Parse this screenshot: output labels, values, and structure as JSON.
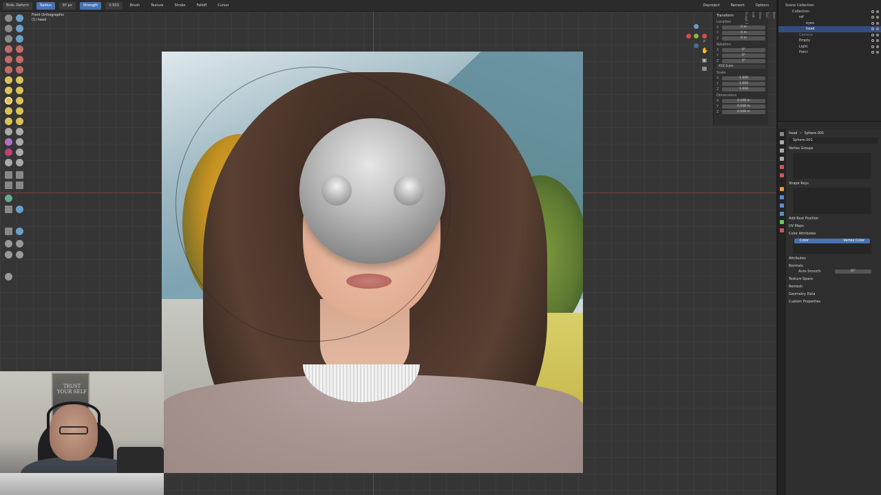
{
  "header": {
    "mode": "Blob",
    "brush_name": "Deform",
    "radius_label": "Radius",
    "radius_value": "97 px",
    "strength_label": "Strength",
    "strength_value": "0.503",
    "menus": [
      "Brush",
      "Texture",
      "Stroke",
      "Falloff",
      "Cursor"
    ]
  },
  "viewport": {
    "view_name": "Front Orthographic",
    "object_label": "(1) head"
  },
  "header_right": [
    "Deproject",
    "Remesh",
    "Options"
  ],
  "npanel": {
    "title": "Transform",
    "location_label": "Location",
    "location": [
      "0 m",
      "0 m",
      "0 m"
    ],
    "rotation_label": "Rotation",
    "rotation": [
      "0°",
      "0°",
      "0°"
    ],
    "rotation_mode": "XYZ Euler",
    "scale_label": "Scale",
    "scale": [
      "1.000",
      "1.000",
      "1.000"
    ],
    "dimensions_label": "Dimensions",
    "dimensions": [
      "0.108 m",
      "0.108 m",
      "0.108 m"
    ],
    "axes": [
      "X",
      "Y",
      "Z"
    ],
    "tabs": [
      "Item",
      "Tool",
      "View",
      "Edit",
      "Sculpt 2"
    ]
  },
  "outliner": {
    "rows": [
      {
        "label": "Scene Collection",
        "indent": 0,
        "selected": false
      },
      {
        "label": "Collection",
        "indent": 1,
        "selected": false
      },
      {
        "label": "ref",
        "indent": 2,
        "selected": false
      },
      {
        "label": "eyes",
        "indent": 3,
        "selected": false
      },
      {
        "label": "head",
        "indent": 3,
        "selected": true
      },
      {
        "label": "Camera",
        "indent": 2,
        "selected": false
      },
      {
        "label": "Empty",
        "indent": 2,
        "selected": false
      },
      {
        "label": "Light",
        "indent": 2,
        "selected": false
      },
      {
        "label": "Point",
        "indent": 2,
        "selected": false
      }
    ]
  },
  "properties": {
    "breadcrumb_object": "head",
    "breadcrumb_mesh": "Sphere.001",
    "mesh_name": "Sphere.001",
    "vertex_groups": "Vertex Groups",
    "shape_keys": "Shape Keys",
    "add_rest_position": "Add Rest Position",
    "uv_maps": "UV Maps",
    "color_attributes": "Color Attributes",
    "color_item": "Color",
    "color_item_type": "Vertex Color",
    "attributes": "Attributes",
    "normals": "Normals",
    "auto_smooth": "Auto Smooth",
    "auto_smooth_value": "30°",
    "texture_space": "Texture Space",
    "remesh": "Remesh",
    "geometry_data": "Geometry Data",
    "custom_properties": "Custom Properties"
  },
  "webcam": {
    "poster_text": "TRUST YOUR SELF"
  }
}
